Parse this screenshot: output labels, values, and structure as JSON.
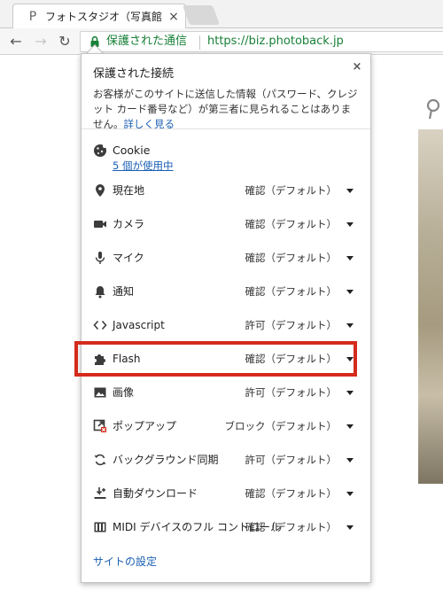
{
  "tab": {
    "title": "フォトスタジオ（写真館）・ｽ",
    "close": "×",
    "favicon": "P"
  },
  "toolbar": {
    "back": "←",
    "forward": "→",
    "reload": "↻",
    "secure_label": "保護された通信",
    "url": "https://biz.photoback.jp"
  },
  "popup": {
    "close": "×",
    "title": "保護された接続",
    "description": "お客様がこのサイトに送信した情報（パスワード、クレジット カード番号など）が第三者に見られることはありません。",
    "learn_more": "詳しく見る",
    "cookie": {
      "label": "Cookie",
      "link": "5 個が使用中"
    },
    "permissions": [
      {
        "icon": "location-icon",
        "label": "現在地",
        "value": "確認（デフォルト）"
      },
      {
        "icon": "camera-icon",
        "label": "カメラ",
        "value": "確認（デフォルト）"
      },
      {
        "icon": "microphone-icon",
        "label": "マイク",
        "value": "確認（デフォルト）"
      },
      {
        "icon": "bell-icon",
        "label": "通知",
        "value": "確認（デフォルト）"
      },
      {
        "icon": "code-icon",
        "label": "Javascript",
        "value": "許可（デフォルト）"
      },
      {
        "icon": "puzzle-icon",
        "label": "Flash",
        "value": "確認（デフォルト）"
      },
      {
        "icon": "image-icon",
        "label": "画像",
        "value": "許可（デフォルト）"
      },
      {
        "icon": "popup-icon",
        "label": "ポップアップ",
        "value": "ブロック（デフォルト）"
      },
      {
        "icon": "sync-icon",
        "label": "バックグラウンド同期",
        "value": "許可（デフォルト）"
      },
      {
        "icon": "download-icon",
        "label": "自動ダウンロード",
        "value": "確認（デフォルト）"
      },
      {
        "icon": "piano-icon",
        "label": "MIDI デバイスのフル コントロール",
        "value": "確認（デフォルト）"
      }
    ],
    "site_settings": "サイトの設定"
  },
  "colors": {
    "secure_green": "#188038",
    "link_blue": "#1a5fb4",
    "highlight_red": "#d42b1c"
  }
}
